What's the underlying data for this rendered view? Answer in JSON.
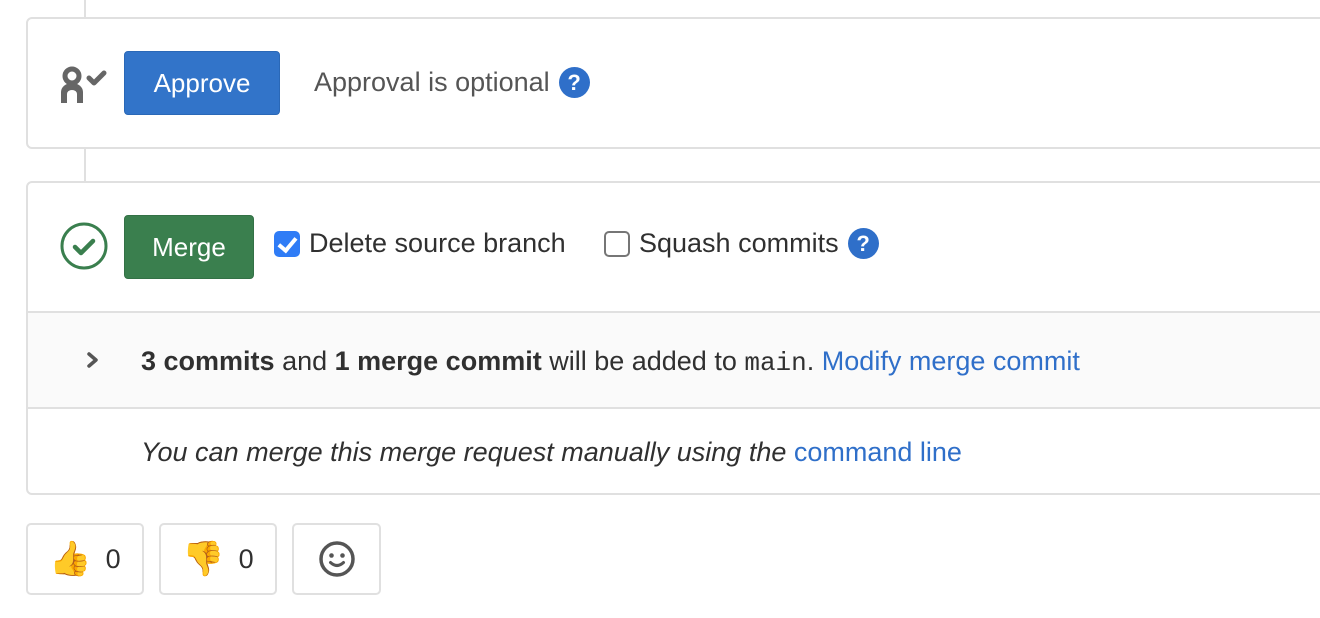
{
  "approval": {
    "approve_button_label": "Approve",
    "status_text": "Approval is optional",
    "help_icon": "question-circle-icon",
    "status_icon": "approval-user-check-icon"
  },
  "merge": {
    "status_icon": "check-circle-icon",
    "merge_button_label": "Merge",
    "options": [
      {
        "label": "Delete source branch",
        "checked": true
      },
      {
        "label": "Squash commits",
        "checked": false
      }
    ],
    "squash_help_icon": "question-circle-icon",
    "commit_summary": {
      "commit_count": "3 commits",
      "and_text": " and ",
      "merge_commit_count": "1 merge commit",
      "added_text": " will be added to ",
      "target_branch": "main",
      "period": ".",
      "modify_link": "Modify merge commit"
    },
    "manual_merge": {
      "text": "You can merge this merge request manually using the ",
      "link": "command line"
    }
  },
  "reactions": [
    {
      "name": "thumbs-up",
      "emoji": "👍",
      "count": "0"
    },
    {
      "name": "thumbs-down",
      "emoji": "👎",
      "count": "0"
    },
    {
      "name": "add-reaction",
      "icon": "smiley-face-icon"
    }
  ],
  "colors": {
    "approve_blue": "#3274c9",
    "merge_green": "#3a7f4e",
    "link_blue": "#2f6fc9",
    "checkbox_blue": "#2f7cf6"
  }
}
